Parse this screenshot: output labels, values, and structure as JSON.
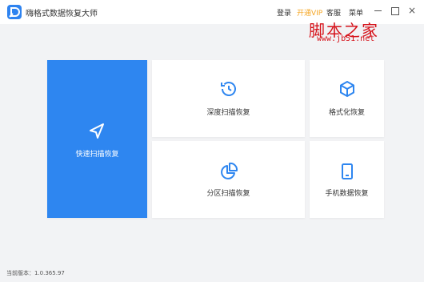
{
  "app": {
    "title": "嗨格式数据恢复大师",
    "logo_letter": "D"
  },
  "header": {
    "login": "登录",
    "vip": "开通VIP",
    "service": "客服",
    "menu": "菜单",
    "close_glyph": "×"
  },
  "watermark": {
    "text": "脚本之家",
    "url": "www.jb51.net"
  },
  "tiles": {
    "quick_scan": "快速扫描恢复",
    "deep_scan": "深度扫描恢复",
    "format_recovery": "格式化恢复",
    "partition_scan": "分区扫描恢复",
    "phone_recovery": "手机数据恢复"
  },
  "footer": {
    "version": "当前版本：1.0.365.97"
  },
  "colors": {
    "accent": "#2e86f0",
    "vip": "#f5a623",
    "watermark": "#d6121a"
  }
}
